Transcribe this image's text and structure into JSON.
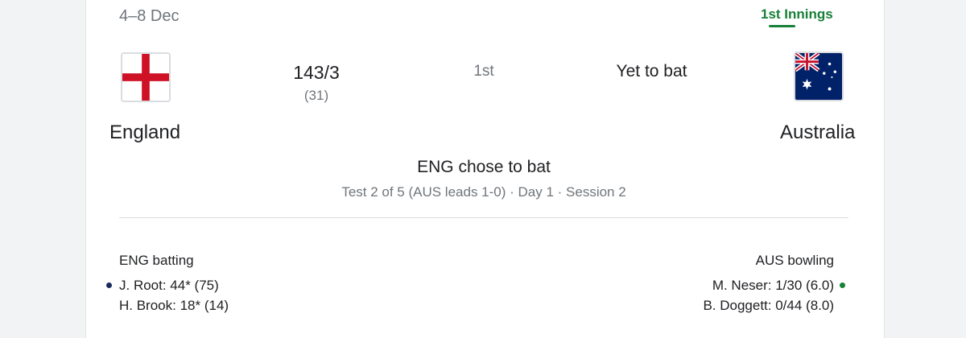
{
  "match": {
    "date": "4–8 Dec",
    "innings_tab": "1st Innings",
    "innings_number": "1st",
    "toss": "ENG chose to bat",
    "series_status": "Test 2 of 5 (AUS leads 1-0) · Day 1 · Session 2"
  },
  "teams": {
    "england": {
      "name": "England",
      "score": "143/3",
      "overs": "(31)",
      "flag_icon": "england-flag-icon",
      "colors": {
        "cross": "#ce1124",
        "field": "#ffffff"
      }
    },
    "australia": {
      "name": "Australia",
      "status": "Yet to bat",
      "flag_icon": "australia-flag-icon",
      "colors": {
        "field": "#012169",
        "cross": "#c8102e",
        "stars": "#ffffff"
      }
    }
  },
  "batting": {
    "label": "ENG batting",
    "players": [
      {
        "line": "J. Root: 44* (75)"
      },
      {
        "line": "H. Brook: 18* (14)"
      }
    ]
  },
  "bowling": {
    "label": "AUS bowling",
    "players": [
      {
        "line": "M. Neser: 1/30 (6.0)"
      },
      {
        "line": "B. Doggett: 0/44 (8.0)"
      }
    ]
  },
  "colors": {
    "accent": "#188038",
    "eng_indicator": "#1a2a5e",
    "aus_indicator": "#188038",
    "primary_text": "#202124",
    "secondary_text": "#70757a"
  }
}
